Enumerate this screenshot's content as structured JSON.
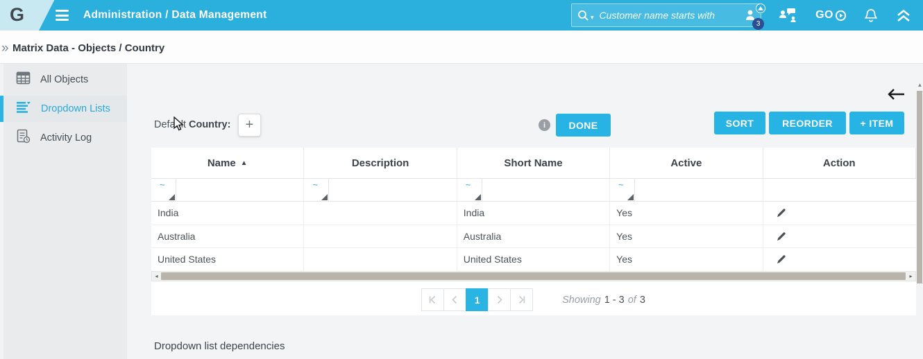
{
  "icons": {
    "logo": "G",
    "breadcrumb_chevrons": "»",
    "plus": "+",
    "info": "i",
    "filter_operator": "~",
    "sort_asc": "▲",
    "go_label": "GO",
    "badge_count": "3",
    "mag_caret": "▾",
    "hscroll_left": "◂",
    "hscroll_right": "▸",
    "vscroll_up": "▲"
  },
  "header": {
    "title": "Administration / Data Management",
    "search_placeholder": "Customer name starts with"
  },
  "breadcrumb": "Matrix Data - Objects / Country",
  "sidebar": {
    "items": [
      {
        "label": "All Objects"
      },
      {
        "label": "Dropdown Lists"
      },
      {
        "label": "Activity Log"
      }
    ]
  },
  "toolbar": {
    "label_prefix": "Default ",
    "label_object": "Country:",
    "done": "DONE",
    "sort": "SORT",
    "reorder": "REORDER",
    "add_item": "+ ITEM"
  },
  "table": {
    "columns": [
      "Name",
      "Description",
      "Short Name",
      "Active",
      "Action"
    ],
    "sorted_by": "Name ascending",
    "rows": [
      {
        "name": "India",
        "description": "",
        "short_name": "India",
        "active": "Yes"
      },
      {
        "name": "Australia",
        "description": "",
        "short_name": "Australia",
        "active": "Yes"
      },
      {
        "name": "United States",
        "description": "",
        "short_name": "United States",
        "active": "Yes"
      }
    ]
  },
  "pagination": {
    "current_page": "1",
    "showing_label": "Showing",
    "range": "1 - 3",
    "of_label": "of",
    "total": "3"
  },
  "footer": {
    "section_title": "Dropdown list dependencies"
  },
  "colors": {
    "header_cyan": "#2bb0de",
    "accent_cyan": "#27b3e3",
    "badge_navy": "#2b4d94",
    "sidebar_bg": "#e9ebec",
    "content_bg": "#f2f4f5",
    "scrollbar_thumb": "#b8b4ab"
  }
}
